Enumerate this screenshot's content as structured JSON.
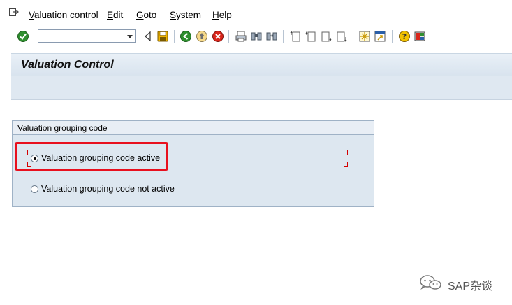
{
  "menu": {
    "items": [
      {
        "label": "Valuation control",
        "accel_index": 0
      },
      {
        "label": "Edit",
        "accel_index": 0
      },
      {
        "label": "Goto",
        "accel_index": 0
      },
      {
        "label": "System",
        "accel_index": 0
      },
      {
        "label": "Help",
        "accel_index": 0
      }
    ]
  },
  "toolbar": {
    "command_field": {
      "value": "",
      "placeholder": ""
    }
  },
  "screen": {
    "title": "Valuation Control"
  },
  "group": {
    "title": "Valuation grouping code",
    "options": [
      {
        "label": "Valuation grouping code active",
        "selected": true
      },
      {
        "label": "Valuation grouping code not active",
        "selected": false
      }
    ]
  },
  "watermark": {
    "text": "SAP杂谈"
  },
  "colors": {
    "highlight": "#e8101e",
    "header_bg": "#dfe8f1",
    "group_bg": "#dde7f0"
  }
}
